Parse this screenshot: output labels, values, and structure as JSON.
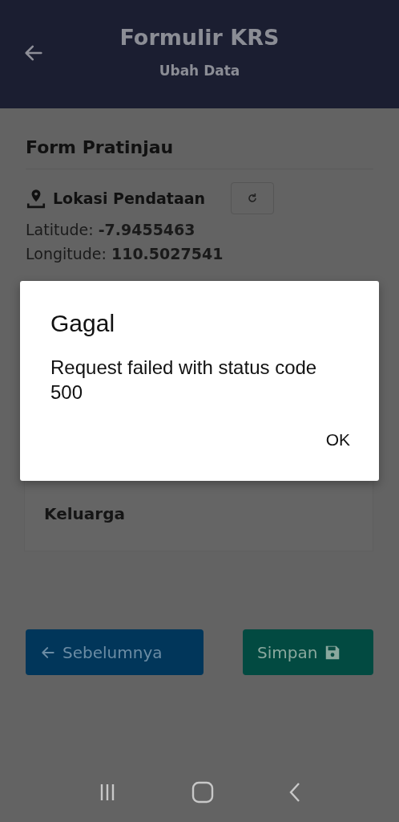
{
  "header": {
    "title": "Formulir KRS",
    "subtitle": "Ubah Data"
  },
  "form": {
    "title": "Form Pratinjau",
    "location_label": "Lokasi Pendataan",
    "coordinates": [
      {
        "label": "Latitude:",
        "value": "-7.9455463"
      },
      {
        "label": "Longitude:",
        "value": "110.5027541"
      }
    ],
    "section": "Keluarga"
  },
  "buttons": [
    {
      "kind": "previous",
      "label": "Sebelumnya"
    },
    {
      "kind": "save",
      "label": "Simpan"
    }
  ],
  "dialog": {
    "title": "Gagal",
    "message": "Request failed with status code 500",
    "action": "OK"
  }
}
